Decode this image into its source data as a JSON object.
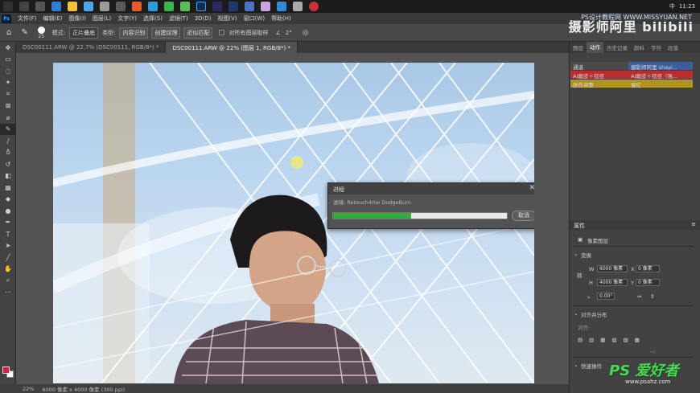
{
  "taskbar": {
    "clock": "11:23",
    "lang": "中"
  },
  "menu": [
    "文件(F)",
    "编辑(E)",
    "图像(I)",
    "图层(L)",
    "文字(Y)",
    "选择(S)",
    "滤镜(T)",
    "3D(D)",
    "视图(V)",
    "窗口(W)",
    "帮助(H)"
  ],
  "options": {
    "brush_size": "25",
    "mode_label": "模式:",
    "mode_value": "正片叠底",
    "type_label": "类型:",
    "type_btn1": "内容识别",
    "type_btn2": "创建纹理",
    "type_btn3": "近似匹配",
    "sample_all": "对所有图层取样",
    "angle": "2°"
  },
  "watermarks": {
    "top_site": "PS设计教程网 WWW.MISSYUAN.NET",
    "top_brand": "摄影师阿里 bilibili",
    "bottom_brand": "PS 爱好者",
    "bottom_url": "www.psahz.com"
  },
  "tabs": [
    {
      "label": "DSC00111.ARW @ 22.7% (DSC00111, RGB/8*) *"
    },
    {
      "label": "DSC00111.ARW @ 22% (图层 1, RGB/8*) *"
    }
  ],
  "dialog": {
    "title": "进程",
    "label": "滤镜: Retouch4me DodgeBurn",
    "progress": 0.45,
    "cancel": "取消"
  },
  "status": {
    "zoom": "22%",
    "doc": "6000 像素 x 4000 像素 (300 ppi)"
  },
  "panels": {
    "tabs": [
      "图层",
      "动作",
      "历史记录",
      "颜料",
      "字符",
      "段落"
    ],
    "actions": [
      {
        "name": "通道",
        "value": "摄影师阿里 shayi...",
        "color": "#3b5f9c"
      },
      {
        "name": "AI磨皮＋祛痘",
        "value": "AI磨皮＋祛痘（强...",
        "color": "#b92e2e"
      },
      {
        "name": "肤色调整",
        "value": "偏红",
        "color": "#b39221"
      }
    ],
    "properties": {
      "title": "属性",
      "layer_type": "像素图层",
      "transform": "变换",
      "w": "6000 像素",
      "h": "4000 像素",
      "x": "0 像素",
      "y": "0 像素",
      "angle": "0.00°",
      "align": "对齐并分布",
      "align_label": "对齐:",
      "quick": "快速操作"
    }
  }
}
